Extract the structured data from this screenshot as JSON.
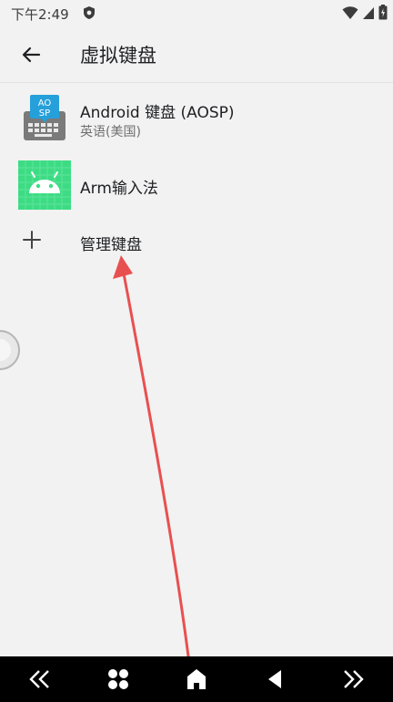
{
  "status_bar": {
    "time": "下午2:49"
  },
  "app_bar": {
    "title": "虚拟键盘"
  },
  "keyboards": [
    {
      "title": "Android 键盘 (AOSP)",
      "subtitle": "英语(美国)",
      "icon_text_top": "AO",
      "icon_text_bottom": "SP",
      "icon": "aosp-keyboard-icon"
    },
    {
      "title": "Arm输入法",
      "icon": "android-robot-icon"
    }
  ],
  "manage": {
    "label": "管理键盘",
    "icon": "plus-icon"
  },
  "nav_bar": {
    "buttons": [
      "double-chevron-left-icon",
      "four-dots-icon",
      "home-icon",
      "back-triangle-icon",
      "double-chevron-right-icon"
    ]
  },
  "colors": {
    "background": "#f2f2f2",
    "aosp_blue": "#26a0da",
    "android_green": "#3ddc84",
    "annotation_red": "#e85050"
  }
}
